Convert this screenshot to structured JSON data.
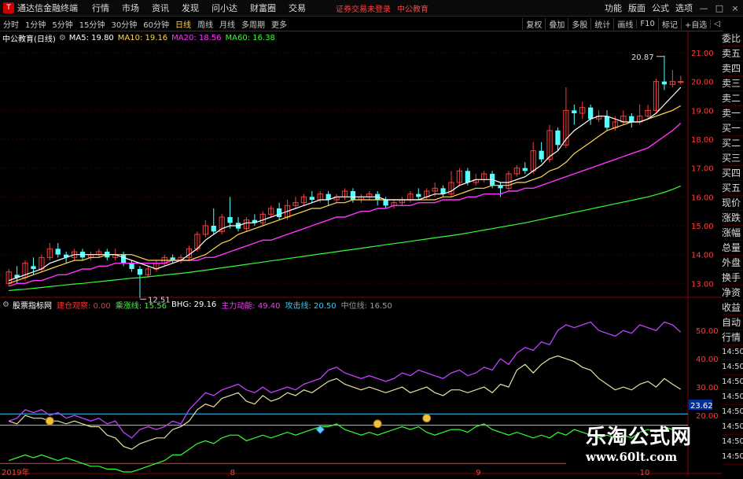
{
  "app": {
    "title": "通达信金融终端",
    "logo": "T"
  },
  "menu": [
    "行情",
    "市场",
    "资讯",
    "发现",
    "问小达",
    "财富圈",
    "交易"
  ],
  "login_status": "证券交易未登录",
  "top_stock": "中公教育",
  "right_menu": [
    "功能",
    "版面",
    "公式",
    "选项"
  ],
  "window_buttons": [
    "—",
    "□",
    "×"
  ],
  "toolbar": {
    "periods": [
      "分时",
      "1分钟",
      "5分钟",
      "15分钟",
      "30分钟",
      "60分钟",
      "日线",
      "周线",
      "月线",
      "多周期",
      "更多"
    ],
    "active": "日线",
    "tools": [
      "复权",
      "叠加",
      "多股",
      "统计",
      "画线",
      "F10",
      "标记",
      "+自选",
      "◁"
    ]
  },
  "info": {
    "stock": "中公教育(日线)",
    "ma": [
      {
        "label": "MA5: 19.80",
        "color": "#ffffff"
      },
      {
        "label": "MA10: 19.16",
        "color": "#ffd84d"
      },
      {
        "label": "MA20: 18.56",
        "color": "#ff33ff"
      },
      {
        "label": "MA60: 16.38",
        "color": "#33ff33"
      }
    ]
  },
  "indicator": {
    "name": "股票指标网",
    "items": [
      {
        "label": "建仓观察: 0.00",
        "color": "#ff3030"
      },
      {
        "label": "乘涨线: 15.56",
        "color": "#33ff33"
      },
      {
        "label": "BHG: 29.16",
        "color": "#ffffff"
      },
      {
        "label": "主力动能: 49.40",
        "color": "#ff33ff"
      },
      {
        "label": "攻击线: 20.50",
        "color": "#33ccff"
      },
      {
        "label": "中位线: 16.50",
        "color": "#999999"
      }
    ]
  },
  "side_list": [
    "委比",
    "卖五",
    "卖四",
    "卖三",
    "卖二",
    "卖一",
    "买一",
    "买二",
    "买三",
    "买四",
    "买五",
    "现价",
    "涨跌",
    "涨幅",
    "总量",
    "外盘",
    "换手",
    "净资",
    "收益",
    "自动",
    "行情",
    "14:50",
    "14:50",
    "14:50",
    "14:50",
    "14:50",
    "14:50",
    "14:50",
    "14:50"
  ],
  "price_axis": [
    "21.00",
    "20.00",
    "19.00",
    "18.00",
    "17.00",
    "16.00",
    "15.00",
    "14.00",
    "13.00"
  ],
  "ind_axis": [
    "50.00",
    "40.00",
    "30.00",
    "20.00"
  ],
  "ind_current": "23.62",
  "x_axis": [
    "2019年",
    "8",
    "9",
    "10"
  ],
  "annotations": {
    "high": "20.87",
    "low": "12.51"
  },
  "chart_data": {
    "type": "candlestick",
    "ylim": [
      12.6,
      21.3
    ],
    "candles": [
      [
        13.0,
        13.4,
        12.9,
        13.5
      ],
      [
        13.3,
        13.2,
        13.0,
        13.6
      ],
      [
        13.2,
        13.7,
        13.1,
        13.8
      ],
      [
        13.6,
        13.5,
        13.3,
        13.9
      ],
      [
        13.5,
        13.9,
        13.4,
        14.0
      ],
      [
        13.9,
        14.2,
        13.8,
        14.4
      ],
      [
        14.2,
        14.0,
        13.9,
        14.4
      ],
      [
        14.0,
        13.9,
        13.7,
        14.1
      ],
      [
        13.9,
        14.1,
        13.8,
        14.2
      ],
      [
        14.1,
        13.9,
        13.8,
        14.2
      ],
      [
        13.9,
        14.0,
        13.8,
        14.1
      ],
      [
        14.0,
        14.1,
        13.9,
        14.2
      ],
      [
        14.1,
        13.9,
        13.8,
        14.2
      ],
      [
        13.9,
        14.0,
        13.8,
        14.2
      ],
      [
        14.0,
        13.7,
        13.6,
        14.1
      ],
      [
        13.7,
        13.5,
        13.4,
        13.8
      ],
      [
        13.5,
        13.3,
        12.5,
        13.6
      ],
      [
        13.3,
        13.5,
        13.2,
        13.6
      ],
      [
        13.5,
        13.7,
        13.4,
        13.8
      ],
      [
        13.7,
        13.9,
        13.6,
        14.0
      ],
      [
        13.9,
        13.8,
        13.7,
        14.0
      ],
      [
        13.8,
        13.9,
        13.7,
        14.0
      ],
      [
        13.9,
        14.2,
        13.8,
        14.3
      ],
      [
        14.2,
        14.7,
        14.1,
        14.8
      ],
      [
        14.7,
        15.0,
        14.6,
        15.2
      ],
      [
        15.0,
        14.8,
        14.7,
        15.6
      ],
      [
        14.8,
        15.3,
        14.7,
        15.4
      ],
      [
        15.3,
        15.1,
        14.9,
        16.0
      ],
      [
        15.1,
        14.9,
        14.8,
        15.3
      ],
      [
        14.9,
        15.2,
        14.8,
        15.3
      ],
      [
        15.2,
        15.1,
        15.0,
        15.4
      ],
      [
        15.1,
        15.4,
        15.0,
        15.5
      ],
      [
        15.4,
        15.6,
        15.3,
        15.7
      ],
      [
        15.6,
        15.3,
        15.2,
        15.8
      ],
      [
        15.3,
        15.7,
        15.2,
        15.9
      ],
      [
        15.7,
        15.8,
        15.6,
        16.0
      ],
      [
        15.8,
        16.0,
        15.7,
        16.1
      ],
      [
        16.0,
        15.9,
        15.8,
        16.2
      ],
      [
        15.9,
        16.1,
        15.8,
        16.2
      ],
      [
        16.1,
        15.9,
        15.7,
        16.2
      ],
      [
        15.9,
        16.0,
        15.8,
        16.1
      ],
      [
        16.0,
        16.2,
        15.9,
        16.3
      ],
      [
        16.2,
        15.9,
        15.8,
        16.3
      ],
      [
        15.9,
        16.0,
        15.8,
        16.1
      ],
      [
        16.0,
        16.1,
        15.9,
        16.2
      ],
      [
        16.1,
        15.9,
        15.7,
        16.2
      ],
      [
        15.9,
        15.7,
        15.6,
        16.0
      ],
      [
        15.7,
        15.8,
        15.6,
        15.9
      ],
      [
        15.8,
        15.9,
        15.7,
        16.0
      ],
      [
        15.9,
        16.1,
        15.8,
        16.2
      ],
      [
        16.1,
        16.0,
        15.9,
        16.3
      ],
      [
        16.0,
        16.2,
        15.9,
        16.3
      ],
      [
        16.2,
        16.3,
        16.0,
        16.5
      ],
      [
        16.3,
        16.1,
        16.0,
        16.4
      ],
      [
        16.1,
        16.5,
        16.0,
        16.9
      ],
      [
        16.5,
        16.9,
        16.4,
        17.0
      ],
      [
        16.9,
        16.5,
        16.4,
        17.0
      ],
      [
        16.5,
        16.6,
        16.4,
        16.8
      ],
      [
        16.6,
        16.8,
        16.5,
        16.9
      ],
      [
        16.8,
        16.4,
        16.3,
        16.9
      ],
      [
        16.4,
        16.3,
        16.0,
        16.5
      ],
      [
        16.3,
        16.8,
        16.2,
        16.9
      ],
      [
        16.8,
        17.0,
        16.7,
        17.1
      ],
      [
        17.0,
        16.9,
        16.8,
        17.2
      ],
      [
        16.9,
        17.6,
        16.8,
        17.9
      ],
      [
        17.6,
        17.3,
        17.2,
        17.9
      ],
      [
        17.3,
        18.3,
        17.2,
        18.5
      ],
      [
        18.3,
        17.8,
        17.6,
        18.4
      ],
      [
        17.8,
        19.0,
        17.7,
        19.8
      ],
      [
        19.0,
        18.9,
        18.5,
        19.2
      ],
      [
        18.9,
        19.1,
        18.7,
        19.3
      ],
      [
        19.1,
        18.7,
        18.5,
        19.2
      ],
      [
        18.7,
        18.8,
        18.6,
        19.0
      ],
      [
        18.8,
        18.4,
        18.3,
        19.0
      ],
      [
        18.4,
        18.6,
        18.3,
        18.8
      ],
      [
        18.6,
        18.8,
        18.5,
        19.0
      ],
      [
        18.8,
        18.6,
        18.4,
        18.9
      ],
      [
        18.6,
        18.8,
        18.5,
        19.2
      ],
      [
        18.8,
        19.0,
        18.7,
        19.2
      ],
      [
        19.0,
        20.0,
        18.9,
        20.1
      ],
      [
        20.0,
        19.9,
        19.7,
        20.9
      ],
      [
        19.9,
        20.0,
        19.8,
        20.4
      ],
      [
        20.0,
        20.0,
        19.9,
        20.2
      ]
    ],
    "ma5": [
      13.1,
      13.2,
      13.3,
      13.4,
      13.5,
      13.7,
      13.8,
      13.9,
      14.0,
      14.0,
      14.0,
      14.0,
      14.0,
      14.0,
      13.9,
      13.8,
      13.7,
      13.6,
      13.5,
      13.6,
      13.7,
      13.8,
      14.0,
      14.2,
      14.5,
      14.7,
      14.9,
      15.0,
      15.0,
      15.1,
      15.1,
      15.2,
      15.3,
      15.4,
      15.5,
      15.6,
      15.7,
      15.8,
      15.9,
      15.9,
      16.0,
      16.0,
      16.0,
      16.0,
      16.0,
      16.0,
      15.9,
      15.9,
      15.9,
      15.9,
      15.9,
      16.0,
      16.1,
      16.1,
      16.2,
      16.4,
      16.5,
      16.6,
      16.6,
      16.6,
      16.5,
      16.5,
      16.6,
      16.7,
      16.9,
      17.1,
      17.4,
      17.6,
      18.0,
      18.3,
      18.5,
      18.7,
      18.8,
      18.8,
      18.7,
      18.6,
      18.6,
      18.6,
      18.7,
      18.9,
      19.2,
      19.5,
      19.8
    ],
    "ma10": [
      13.0,
      13.1,
      13.2,
      13.3,
      13.4,
      13.5,
      13.6,
      13.7,
      13.8,
      13.8,
      13.9,
      13.9,
      14.0,
      14.0,
      14.0,
      14.0,
      13.9,
      13.8,
      13.8,
      13.8,
      13.8,
      13.8,
      13.8,
      13.9,
      14.0,
      14.2,
      14.4,
      14.5,
      14.7,
      14.8,
      14.9,
      15.0,
      15.1,
      15.2,
      15.3,
      15.4,
      15.5,
      15.6,
      15.6,
      15.7,
      15.8,
      15.8,
      15.9,
      15.9,
      15.9,
      15.9,
      15.9,
      15.9,
      15.9,
      15.9,
      15.9,
      15.9,
      15.9,
      16.0,
      16.0,
      16.1,
      16.2,
      16.3,
      16.3,
      16.4,
      16.4,
      16.4,
      16.5,
      16.5,
      16.6,
      16.7,
      16.9,
      17.0,
      17.2,
      17.5,
      17.7,
      17.9,
      18.1,
      18.3,
      18.4,
      18.5,
      18.6,
      18.6,
      18.7,
      18.8,
      18.9,
      19.0,
      19.16
    ],
    "ma20": [
      12.9,
      13.0,
      13.0,
      13.1,
      13.1,
      13.2,
      13.3,
      13.3,
      13.4,
      13.5,
      13.5,
      13.6,
      13.6,
      13.7,
      13.7,
      13.7,
      13.7,
      13.7,
      13.7,
      13.7,
      13.8,
      13.8,
      13.8,
      13.8,
      13.9,
      13.9,
      14.0,
      14.1,
      14.2,
      14.3,
      14.4,
      14.5,
      14.5,
      14.6,
      14.7,
      14.8,
      14.9,
      15.0,
      15.1,
      15.2,
      15.3,
      15.3,
      15.4,
      15.5,
      15.5,
      15.6,
      15.6,
      15.7,
      15.7,
      15.7,
      15.8,
      15.8,
      15.8,
      15.9,
      15.9,
      15.9,
      16.0,
      16.0,
      16.1,
      16.1,
      16.1,
      16.2,
      16.2,
      16.3,
      16.3,
      16.4,
      16.5,
      16.6,
      16.7,
      16.8,
      16.9,
      17.0,
      17.1,
      17.2,
      17.3,
      17.4,
      17.5,
      17.6,
      17.7,
      17.9,
      18.1,
      18.3,
      18.56
    ],
    "ma60": [
      12.75,
      12.78,
      12.8,
      12.83,
      12.86,
      12.89,
      12.92,
      12.95,
      12.98,
      13.0,
      13.03,
      13.06,
      13.09,
      13.12,
      13.15,
      13.18,
      13.2,
      13.23,
      13.26,
      13.29,
      13.32,
      13.35,
      13.38,
      13.42,
      13.46,
      13.5,
      13.54,
      13.58,
      13.62,
      13.66,
      13.7,
      13.74,
      13.78,
      13.82,
      13.86,
      13.9,
      13.94,
      13.98,
      14.02,
      14.06,
      14.1,
      14.14,
      14.18,
      14.22,
      14.26,
      14.3,
      14.34,
      14.38,
      14.42,
      14.46,
      14.5,
      14.54,
      14.58,
      14.62,
      14.66,
      14.7,
      14.75,
      14.8,
      14.85,
      14.9,
      14.95,
      15.0,
      15.05,
      15.1,
      15.16,
      15.22,
      15.28,
      15.34,
      15.4,
      15.46,
      15.52,
      15.58,
      15.64,
      15.7,
      15.76,
      15.82,
      15.88,
      15.94,
      16.0,
      16.08,
      16.16,
      16.26,
      16.38
    ],
    "ind_ylim": [
      0,
      57
    ],
    "main_force": [
      18,
      19,
      22,
      21,
      22,
      20,
      21,
      19,
      20,
      19,
      18,
      19,
      17,
      18,
      14,
      12,
      15,
      16,
      15,
      16,
      18,
      17,
      22,
      25,
      28,
      27,
      29,
      30,
      31,
      29,
      28,
      30,
      28,
      29,
      30,
      29,
      31,
      32,
      33,
      36,
      37,
      35,
      34,
      33,
      34,
      33,
      32,
      33,
      35,
      34,
      36,
      35,
      34,
      33,
      35,
      36,
      34,
      35,
      37,
      36,
      40,
      38,
      42,
      44,
      43,
      46,
      45,
      50,
      52,
      51,
      52,
      53,
      50,
      49,
      48,
      50,
      49,
      52,
      51,
      50,
      53,
      52,
      49.4
    ],
    "attack": [
      18,
      17,
      20,
      19,
      19,
      18,
      18,
      17,
      18,
      17,
      16,
      16,
      13,
      12,
      9,
      8,
      10,
      11,
      12,
      12,
      15,
      16,
      18,
      22,
      24,
      23,
      26,
      27,
      28,
      25,
      24,
      27,
      25,
      26,
      28,
      27,
      29,
      28,
      30,
      32,
      33,
      31,
      30,
      29,
      30,
      29,
      28,
      29,
      30,
      28,
      29,
      30,
      28,
      27,
      29,
      29,
      28,
      29,
      30,
      28,
      31,
      30,
      36,
      38,
      35,
      38,
      40,
      41,
      40,
      39,
      37,
      36,
      33,
      31,
      29,
      30,
      29,
      31,
      32,
      30,
      33,
      31,
      29.2
    ],
    "rising": [
      4,
      5,
      6,
      5,
      6,
      5,
      4,
      5,
      4,
      3,
      2,
      2,
      1,
      1,
      0,
      0,
      1,
      2,
      3,
      4,
      6,
      6,
      8,
      10,
      11,
      10,
      12,
      13,
      13,
      11,
      12,
      13,
      12,
      13,
      14,
      13,
      14,
      15,
      16,
      16,
      17,
      15,
      14,
      13,
      14,
      13,
      14,
      15,
      16,
      15,
      16,
      14,
      13,
      14,
      15,
      15,
      14,
      16,
      17,
      15,
      14,
      13,
      14,
      13,
      12,
      13,
      12,
      14,
      13,
      15,
      14,
      13,
      12,
      13,
      12,
      13,
      12,
      14,
      15,
      14,
      16,
      15,
      15.56
    ],
    "upper_line": 20.5,
    "mid_line": 16.5,
    "icons": [
      {
        "i": 5,
        "v": 18,
        "t": "money"
      },
      {
        "i": 38,
        "v": 15,
        "t": "gem"
      },
      {
        "i": 45,
        "v": 17,
        "t": "money"
      },
      {
        "i": 51,
        "v": 19,
        "t": "money"
      }
    ]
  }
}
